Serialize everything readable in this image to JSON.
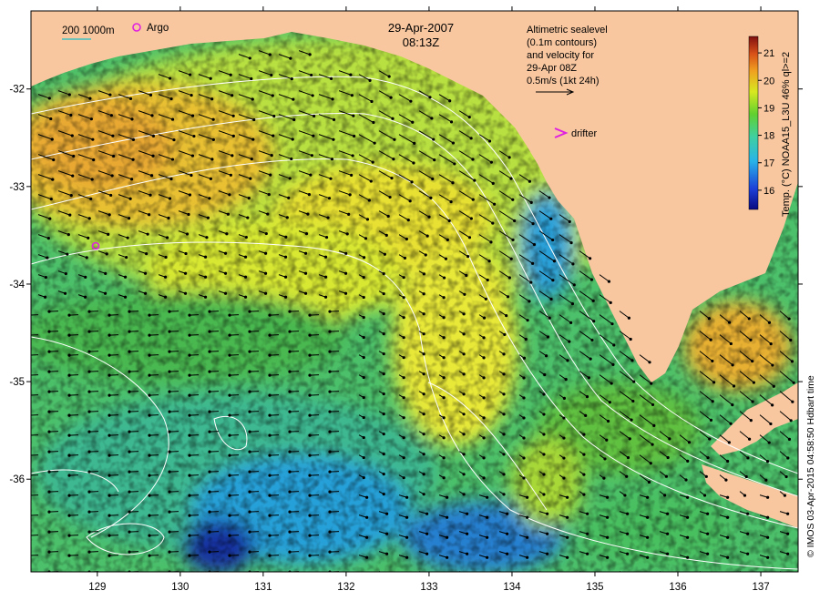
{
  "title": {
    "date": "29-Apr-2007",
    "time": "08:13Z"
  },
  "scale_label": "200  1000m",
  "argo_label": "Argo",
  "info_box": [
    "Altimetric sealevel",
    "(0.1m contours)",
    "and velocity for",
    "29-Apr 08Z",
    "0.5m/s (1kt 24h)"
  ],
  "drifter_label": "drifter",
  "colorbar": {
    "ticks": [
      "21",
      "20",
      "19",
      "18",
      "17",
      "16"
    ],
    "label": "Temp. (°C) NOAA15_L3U 46% ql>=2",
    "range": [
      15.3,
      21.6
    ]
  },
  "credit": "© IMOS 03-Apr-2015 04:58:50 Hdbart time",
  "axes": {
    "x_ticks": [
      "129",
      "130",
      "131",
      "132",
      "133",
      "134",
      "135",
      "136",
      "137"
    ],
    "y_ticks": [
      "-32",
      "-33",
      "-34",
      "-35",
      "-36"
    ],
    "xlim": [
      128.2,
      137.45
    ],
    "ylim": [
      -36.95,
      -31.2
    ]
  },
  "colors": {
    "land": "#f8c7a0",
    "contour": "#ffffff",
    "argo": "#e020e0",
    "drifter": "#e020e0",
    "vector": "#000000"
  }
}
